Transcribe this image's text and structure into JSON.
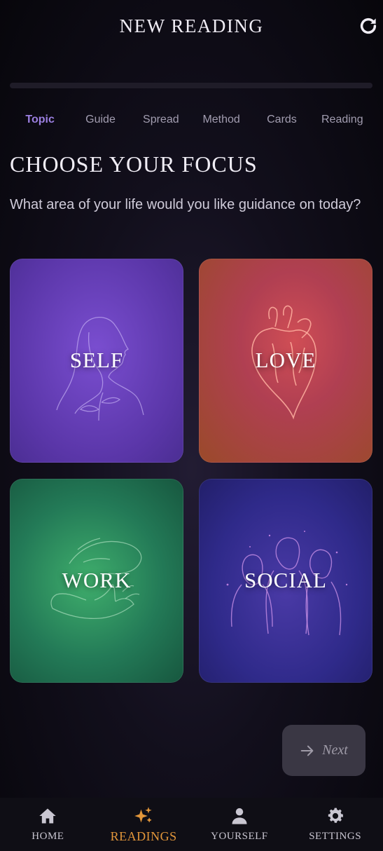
{
  "header": {
    "title": "NEW READING",
    "refresh_icon": "refresh-icon"
  },
  "progress": {
    "fraction": 0.0,
    "accent": "#6e4fc4"
  },
  "steps": [
    {
      "label": "Topic",
      "active": true
    },
    {
      "label": "Guide"
    },
    {
      "label": "Spread"
    },
    {
      "label": "Method"
    },
    {
      "label": "Cards"
    },
    {
      "label": "Reading"
    }
  ],
  "main": {
    "title": "CHOOSE YOUR FOCUS",
    "subtitle": "What area of your life would you like guidance on today?"
  },
  "cards": [
    {
      "label": "SELF",
      "icon": "woman-profile-icon"
    },
    {
      "label": "LOVE",
      "icon": "heart-icon"
    },
    {
      "label": "WORK",
      "icon": "hands-icon"
    },
    {
      "label": "SOCIAL",
      "icon": "people-icon"
    }
  ],
  "next_button": {
    "label": "Next",
    "icon": "arrow-right-icon"
  },
  "bottom_nav": [
    {
      "label": "HOME",
      "icon": "home-icon"
    },
    {
      "label": "READINGS",
      "icon": "sparkles-icon",
      "active": true,
      "color": "#e2963a"
    },
    {
      "label": "YOURSELF",
      "icon": "person-icon"
    },
    {
      "label": "SETTINGS",
      "icon": "gear-icon"
    }
  ]
}
